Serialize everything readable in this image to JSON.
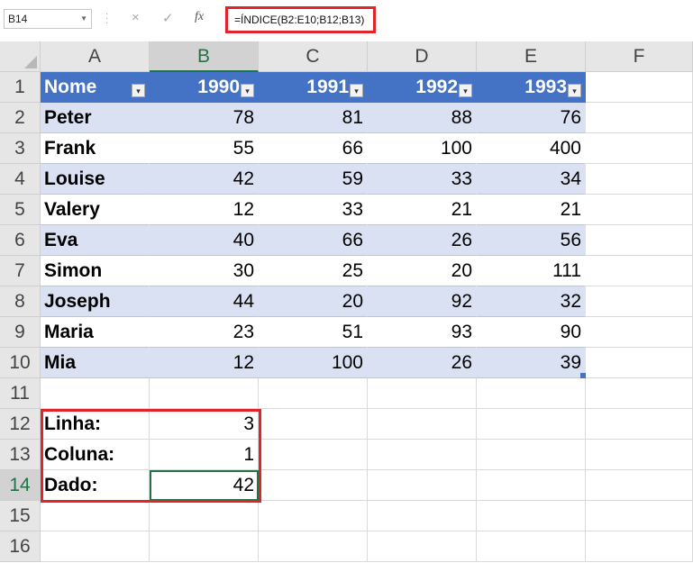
{
  "name_box": "B14",
  "formula": "=ÍNDICE(B2:E10;B12;B13)",
  "icons": {
    "cancel": "×",
    "confirm": "✓",
    "fx": "fx"
  },
  "columns": [
    "A",
    "B",
    "C",
    "D",
    "E",
    "F"
  ],
  "rows": [
    "1",
    "2",
    "3",
    "4",
    "5",
    "6",
    "7",
    "8",
    "9",
    "10",
    "11",
    "12",
    "13",
    "14",
    "15",
    "16"
  ],
  "table": {
    "headers": [
      "Nome",
      "1990",
      "1991",
      "1992",
      "1993"
    ],
    "rows": [
      [
        "Peter",
        "78",
        "81",
        "88",
        "76"
      ],
      [
        "Frank",
        "55",
        "66",
        "100",
        "400"
      ],
      [
        "Louise",
        "42",
        "59",
        "33",
        "34"
      ],
      [
        "Valery",
        "12",
        "33",
        "21",
        "21"
      ],
      [
        "Eva",
        "40",
        "66",
        "26",
        "56"
      ],
      [
        "Simon",
        "30",
        "25",
        "20",
        "111"
      ],
      [
        "Joseph",
        "44",
        "20",
        "92",
        "32"
      ],
      [
        "Maria",
        "23",
        "51",
        "93",
        "90"
      ],
      [
        "Mia",
        "12",
        "100",
        "26",
        "39"
      ]
    ]
  },
  "lookup": [
    {
      "label": "Linha:",
      "value": "3"
    },
    {
      "label": "Coluna:",
      "value": "1"
    },
    {
      "label": "Dado:",
      "value": "42"
    }
  ],
  "colors": {
    "table_header": "#4472c4",
    "band": "#d9e1f2",
    "highlight": "#e2232a",
    "selection": "#217346"
  }
}
